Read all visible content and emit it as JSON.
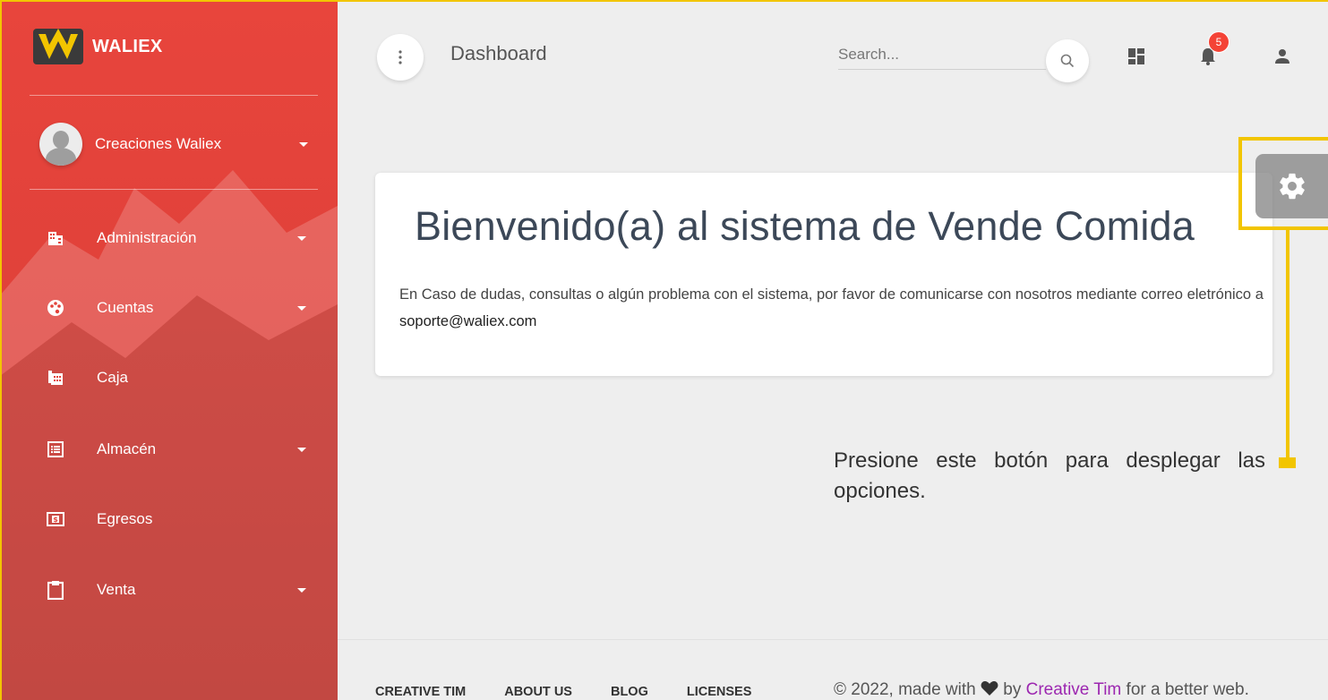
{
  "sidebar": {
    "brand": "WALIEX",
    "user_name": "Creaciones Waliex",
    "items": [
      {
        "label": "Administración",
        "icon": "building-icon",
        "has_caret": true
      },
      {
        "label": "Cuentas",
        "icon": "palette-icon",
        "has_caret": true
      },
      {
        "label": "Caja",
        "icon": "cash-register-icon",
        "has_caret": false
      },
      {
        "label": "Almacén",
        "icon": "list-icon",
        "has_caret": true
      },
      {
        "label": "Egresos",
        "icon": "money-icon",
        "has_caret": false
      },
      {
        "label": "Venta",
        "icon": "clipboard-icon",
        "has_caret": true
      }
    ]
  },
  "header": {
    "title": "Dashboard",
    "search_placeholder": "Search...",
    "notifications_count": "5"
  },
  "card": {
    "title": "Bienvenido(a) al sistema de Vende Comida",
    "message": "En Caso de dudas, consultas o algún problema con el sistema, por favor de comunicarse con nosotros mediante correo eletrónico a ",
    "email": "soporte@waliex.com"
  },
  "annotation": {
    "text": "Presione este botón para desplegar las opciones."
  },
  "footer": {
    "links": [
      "CREATIVE TIM",
      "ABOUT US",
      "BLOG",
      "LICENSES"
    ],
    "copyright_prefix": "© 2022, made with",
    "copyright_by": "by",
    "copyright_link": "Creative Tim",
    "copyright_suffix": "for a better web."
  },
  "colors": {
    "sidebar": "#e8453c",
    "accent": "#f2c500",
    "badge": "#f44336",
    "link": "#9c27b0"
  }
}
